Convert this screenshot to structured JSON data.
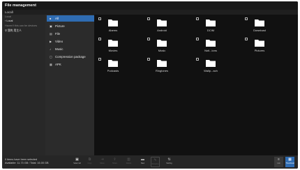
{
  "app": {
    "title": "File management",
    "breadcrumb": "Local\\"
  },
  "sidebar": {
    "local_heading": "Local",
    "local_item": "Local",
    "remote_heading": "Haven't this can be devices",
    "device_item": "我的 用主人"
  },
  "categories": [
    {
      "label": "All",
      "icon": "all-icon",
      "glyph": "■"
    },
    {
      "label": "Picture",
      "icon": "picture-icon",
      "glyph": "▣"
    },
    {
      "label": "File",
      "icon": "file-icon",
      "glyph": "▤"
    },
    {
      "label": "Video",
      "icon": "video-icon",
      "glyph": "▶"
    },
    {
      "label": "Music",
      "icon": "music-icon",
      "glyph": "♪"
    },
    {
      "label": "Compression package",
      "icon": "compression-icon",
      "glyph": "▢"
    },
    {
      "label": "APK",
      "icon": "apk-icon",
      "glyph": "▦"
    }
  ],
  "folders": [
    {
      "name": "Alarms"
    },
    {
      "name": "Android"
    },
    {
      "name": "DCIM"
    },
    {
      "name": "Download"
    },
    {
      "name": "Movies"
    },
    {
      "name": "Music"
    },
    {
      "name": "Noti...ions"
    },
    {
      "name": "Pictures"
    },
    {
      "name": "Podcasts"
    },
    {
      "name": "Ringtones"
    },
    {
      "name": "Wallp...ach"
    }
  ],
  "status": {
    "line1": "0 items have been selected",
    "line2": "Available: 11.73 GB / Total: 16.00 GB"
  },
  "toolbar": [
    {
      "label": "Select all",
      "icon": "select-all-icon",
      "glyph": "▣",
      "enabled": true
    },
    {
      "label": "Copy",
      "icon": "copy-icon",
      "glyph": "⧉",
      "enabled": false
    },
    {
      "label": "Move",
      "icon": "move-icon",
      "glyph": "⇥",
      "enabled": false
    },
    {
      "label": "Share",
      "icon": "share-icon",
      "glyph": "⇪",
      "enabled": false
    },
    {
      "label": "Delete",
      "icon": "delete-icon",
      "glyph": "▥",
      "enabled": false
    },
    {
      "label": "New",
      "icon": "new-folder-icon",
      "glyph": "▬",
      "enabled": true
    },
    {
      "label": "Rename",
      "icon": "rename-icon",
      "glyph": "✎",
      "enabled": false
    },
    {
      "label": "Sorting",
      "icon": "sort-icon",
      "glyph": "⇅",
      "enabled": true
    }
  ],
  "view_toggle": [
    {
      "label": "List",
      "icon": "list-view-icon",
      "glyph": "≡"
    },
    {
      "label": "Thumbnail",
      "icon": "thumbnail-view-icon",
      "glyph": "▦"
    }
  ],
  "colors": {
    "accent": "#2f6cb2",
    "background": "#111111",
    "folder": "#ffffff"
  }
}
